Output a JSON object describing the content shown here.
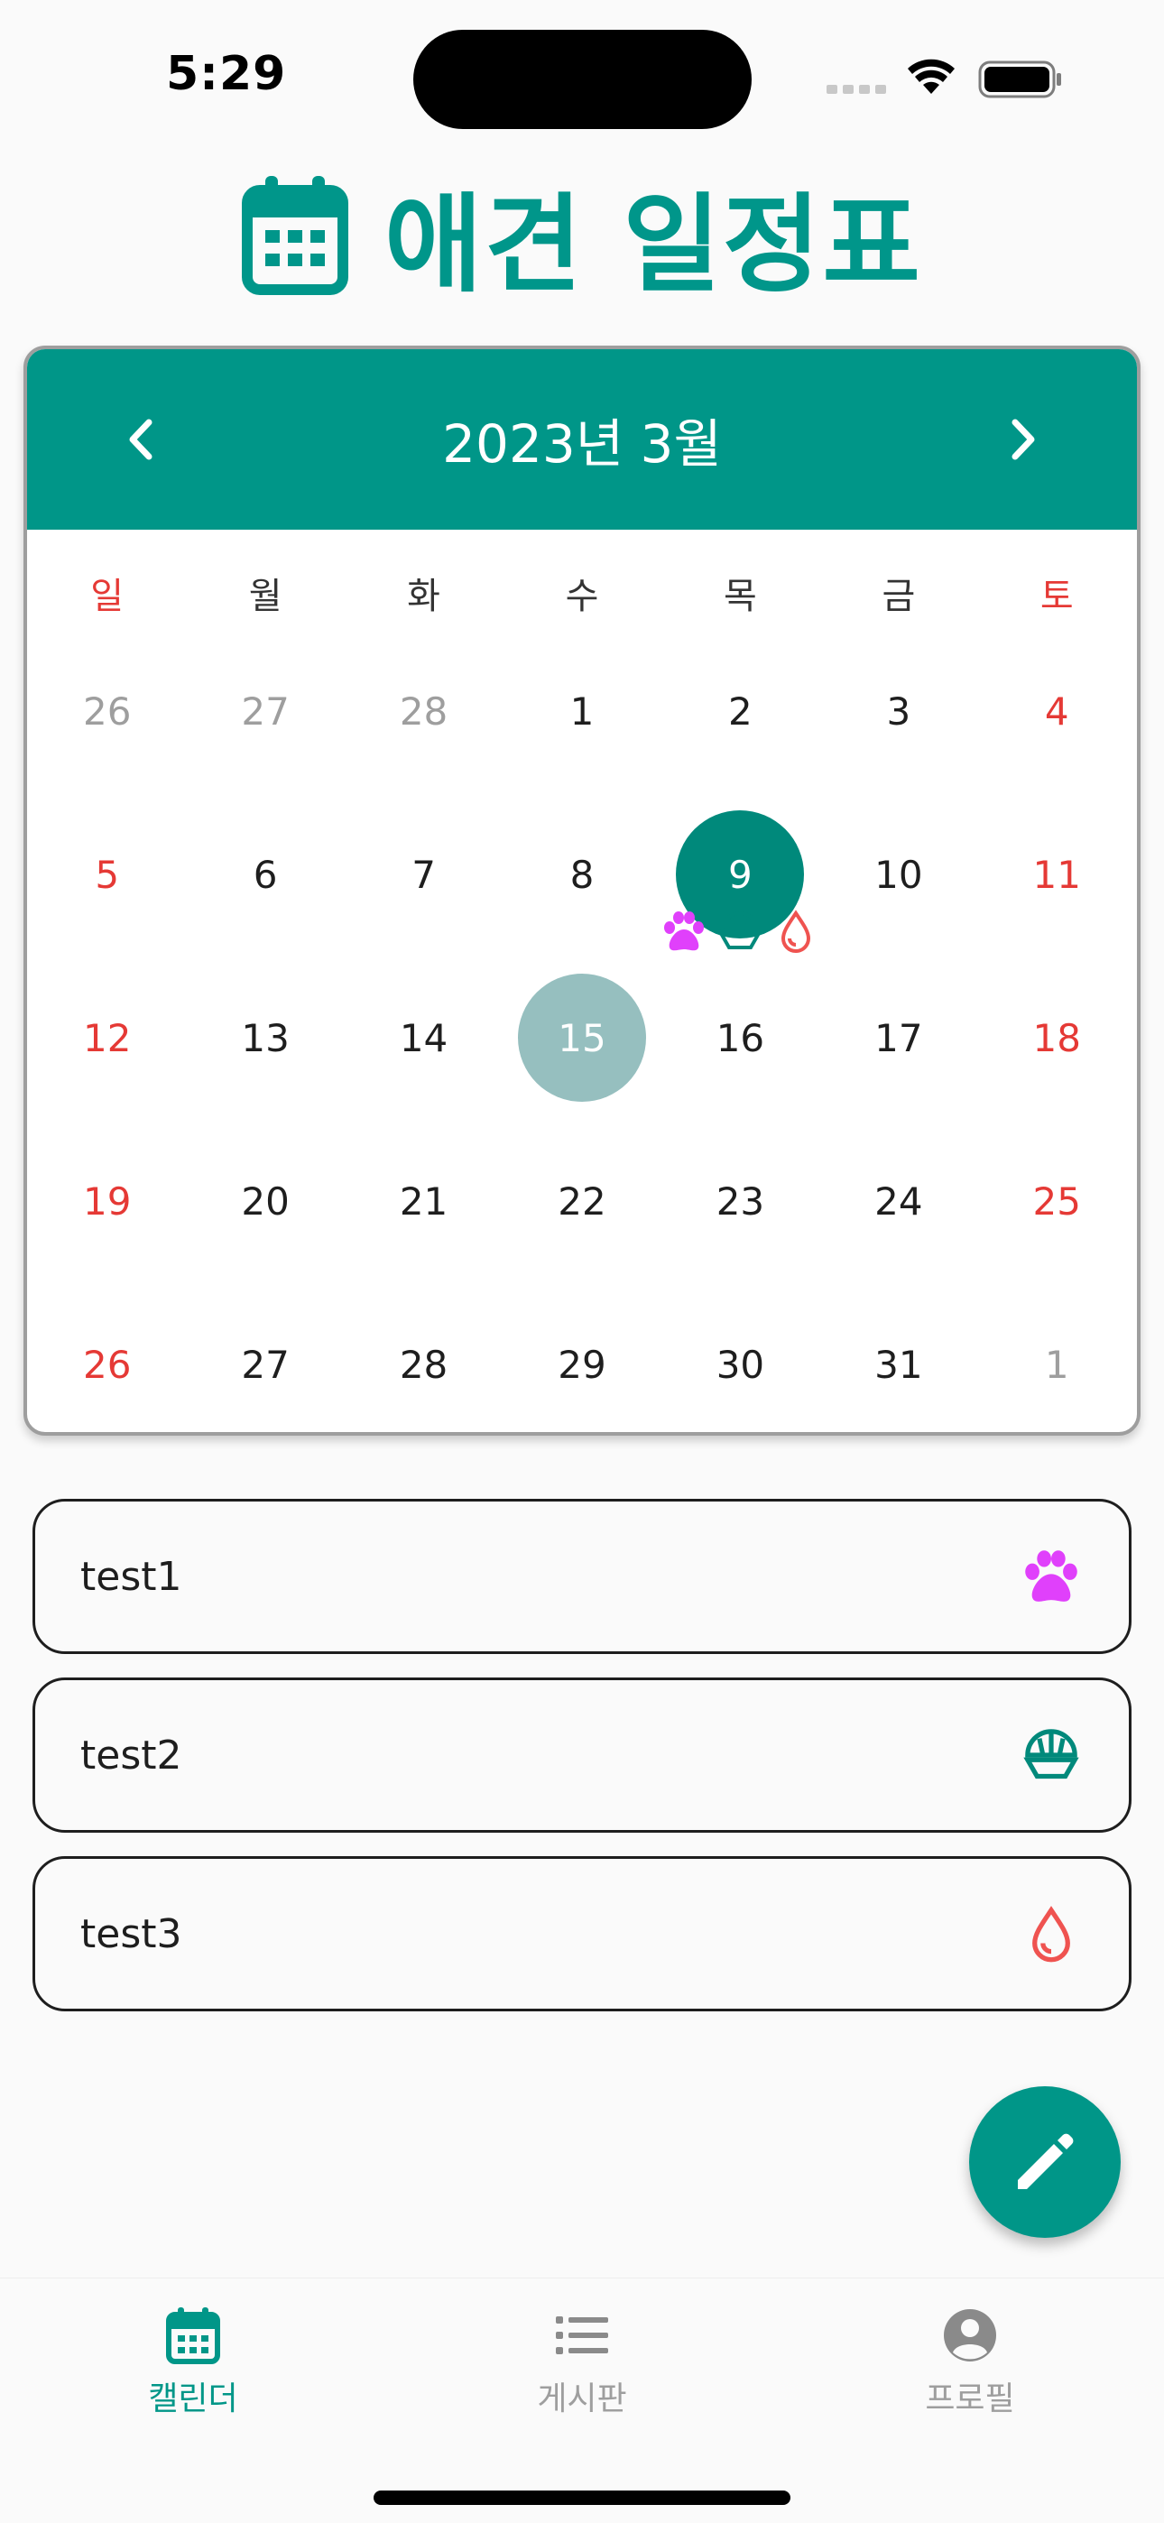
{
  "status_bar": {
    "time": "5:29"
  },
  "header": {
    "title": "애견 일정표",
    "icon": "calendar-icon"
  },
  "calendar": {
    "month_label": "2023년 3월",
    "weekdays": [
      "일",
      "월",
      "화",
      "수",
      "목",
      "금",
      "토"
    ],
    "weeks": [
      [
        "26",
        "27",
        "28",
        "1",
        "2",
        "3",
        "4"
      ],
      [
        "5",
        "6",
        "7",
        "8",
        "9",
        "10",
        "11"
      ],
      [
        "12",
        "13",
        "14",
        "15",
        "16",
        "17",
        "18"
      ],
      [
        "19",
        "20",
        "21",
        "22",
        "23",
        "24",
        "25"
      ],
      [
        "26",
        "27",
        "28",
        "29",
        "30",
        "31",
        "1"
      ]
    ],
    "selected_day": "9",
    "today_day": "15"
  },
  "events": [
    {
      "title": "test1",
      "icon": "paw-icon",
      "color": "#e040fb"
    },
    {
      "title": "test2",
      "icon": "food-bowl-icon",
      "color": "#00897b"
    },
    {
      "title": "test3",
      "icon": "water-drop-icon",
      "color": "#ef5350"
    }
  ],
  "fab": {
    "icon": "pencil-icon"
  },
  "bottom_nav": {
    "items": [
      {
        "label": "캘린더",
        "icon": "calendar-icon",
        "active": true
      },
      {
        "label": "게시판",
        "icon": "list-icon",
        "active": false
      },
      {
        "label": "프로필",
        "icon": "profile-icon",
        "active": false
      }
    ]
  },
  "colors": {
    "primary": "#009688",
    "selected": "#00897b",
    "today": "#96bfbf",
    "weekend": "#e53935"
  }
}
